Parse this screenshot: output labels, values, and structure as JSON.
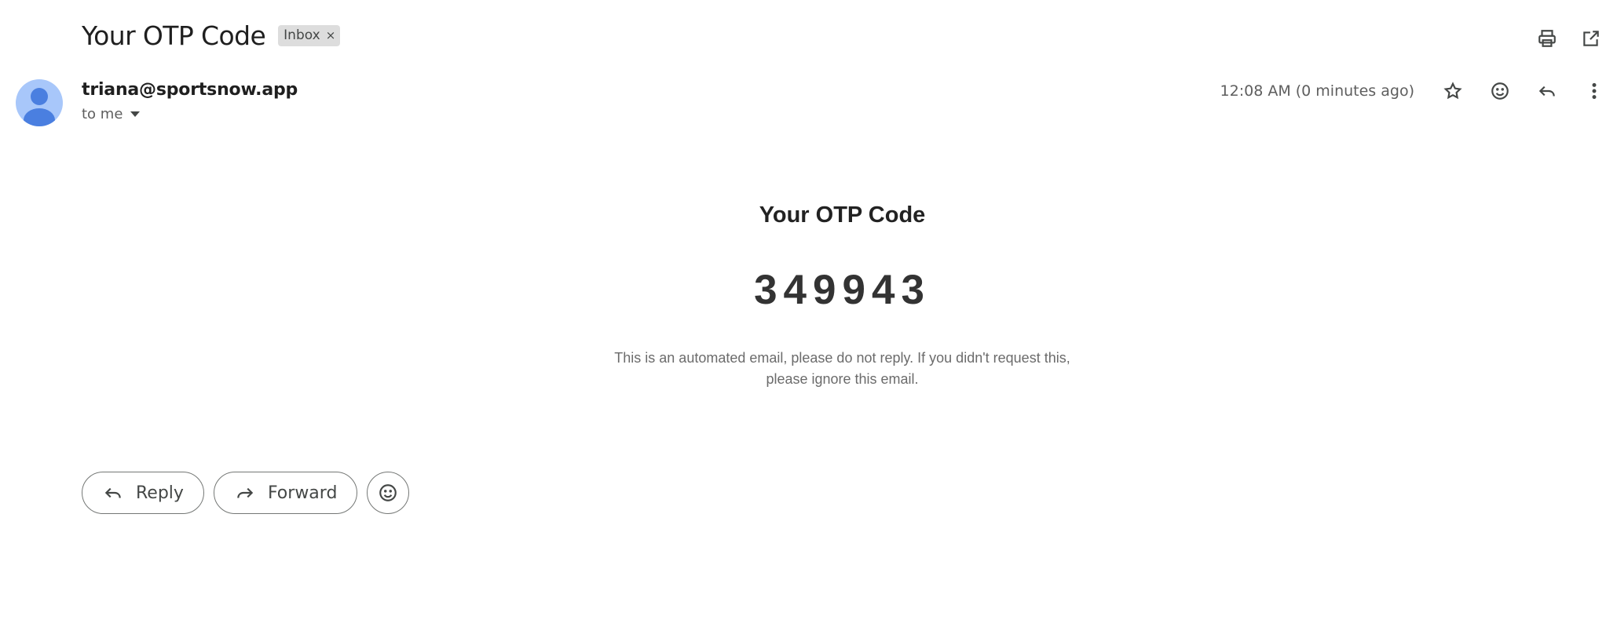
{
  "email": {
    "subject": "Your OTP Code",
    "label": "Inbox",
    "label_remove": "×",
    "sender": "triana@sportsnow.app",
    "recipient": "to me",
    "timestamp": "12:08 AM (0 minutes ago)"
  },
  "top_actions": {
    "icons": [
      "print-icon",
      "open-in-new-window-icon"
    ]
  },
  "meta_actions": {
    "icons": [
      "star-icon",
      "emoji-react-icon",
      "reply-icon",
      "more-vert-icon"
    ]
  },
  "body": {
    "title": "Your OTP Code",
    "code": "349943",
    "note": "This is an automated email, please do not reply. If you didn't request this, please ignore this email."
  },
  "reply_bar": {
    "reply_label": "Reply",
    "forward_label": "Forward",
    "emoji_icon": "emoji-react-icon"
  },
  "colors": {
    "avatar_bg": "#a8c7fa",
    "avatar_fg": "#4a7fe0",
    "chip_bg": "#dddddd"
  }
}
